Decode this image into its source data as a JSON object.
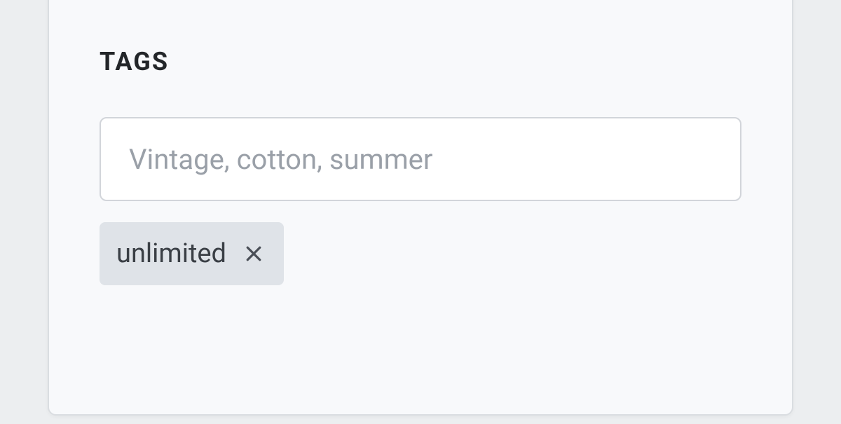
{
  "tags_section": {
    "heading": "TAGS",
    "input_placeholder": "Vintage, cotton, summer",
    "tags": [
      {
        "label": "unlimited"
      }
    ]
  }
}
